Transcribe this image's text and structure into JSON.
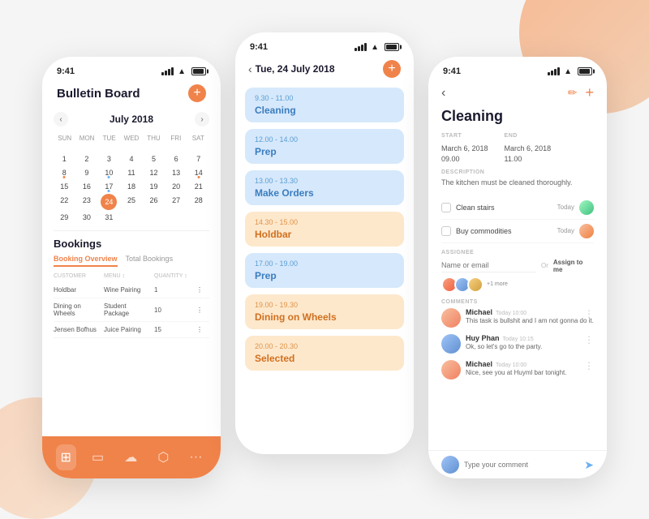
{
  "background": {
    "color": "#f0f0ee"
  },
  "phone1": {
    "status_time": "9:41",
    "header_title": "Bulletin Board",
    "plus_label": "+",
    "calendar": {
      "month": "July 2018",
      "day_names": [
        "SUN",
        "MON",
        "TUE",
        "WED",
        "THU",
        "FRI",
        "SAT"
      ],
      "weeks": [
        [
          {
            "n": ""
          },
          {
            "n": ""
          },
          {
            "n": ""
          },
          {
            "n": ""
          },
          {
            "n": ""
          },
          {
            "n": ""
          },
          {
            "n": ""
          }
        ],
        [
          {
            "n": "1"
          },
          {
            "n": "2"
          },
          {
            "n": "3"
          },
          {
            "n": "4"
          },
          {
            "n": "5"
          },
          {
            "n": "6"
          },
          {
            "n": "7"
          }
        ],
        [
          {
            "n": "8",
            "dot": "orange"
          },
          {
            "n": "9"
          },
          {
            "n": "10",
            "dot": "blue"
          },
          {
            "n": "11"
          },
          {
            "n": "12"
          },
          {
            "n": "13"
          },
          {
            "n": "14",
            "dot": "orange"
          }
        ],
        [
          {
            "n": "15"
          },
          {
            "n": "16"
          },
          {
            "n": "17",
            "dot": "blue"
          },
          {
            "n": "18"
          },
          {
            "n": "19"
          },
          {
            "n": "20"
          },
          {
            "n": "21"
          }
        ],
        [
          {
            "n": "22"
          },
          {
            "n": "23"
          },
          {
            "n": "24",
            "today": true
          },
          {
            "n": "25"
          },
          {
            "n": "26"
          },
          {
            "n": "27"
          },
          {
            "n": "28"
          }
        ],
        [
          {
            "n": "29"
          },
          {
            "n": "30"
          },
          {
            "n": "31"
          },
          {
            "n": ""
          },
          {
            "n": ""
          },
          {
            "n": ""
          },
          {
            "n": ""
          }
        ]
      ]
    },
    "bookings": {
      "title": "Bookings",
      "tabs": [
        "Booking Overview",
        "Total Bookings"
      ],
      "columns": [
        "CUSTOMER",
        "MENU",
        "QUANTITY",
        ""
      ],
      "rows": [
        {
          "customer": "Holdbar",
          "menu": "Wine Pairing",
          "quantity": "1"
        },
        {
          "customer": "Dining on Wheels",
          "menu": "Student Package",
          "quantity": "10"
        },
        {
          "customer": "Jensen Bofhus",
          "menu": "Juice Pairing",
          "quantity": "15"
        }
      ]
    },
    "nav_icons": [
      "⊞",
      "▭",
      "☁",
      "⬡",
      "···"
    ]
  },
  "phone2": {
    "status_time": "9:41",
    "date": "Tue, 24 July 2018",
    "plus_label": "+",
    "items": [
      {
        "time": "9.30 - 11.00",
        "name": "Cleaning",
        "color": "blue"
      },
      {
        "time": "12.00 - 14.00",
        "name": "Prep",
        "color": "blue"
      },
      {
        "time": "13.00 - 13.30",
        "name": "Make Orders",
        "color": "blue"
      },
      {
        "time": "14.30 - 15.00",
        "name": "Holdbar",
        "color": "orange"
      },
      {
        "time": "17.00 - 19.00",
        "name": "Prep",
        "color": "blue"
      },
      {
        "time": "19.00 - 19.30",
        "name": "Dining on Wheels",
        "color": "orange"
      },
      {
        "time": "20.00 - 20.30",
        "name": "Selected",
        "color": "orange"
      }
    ]
  },
  "phone3": {
    "status_time": "9:41",
    "title": "Cleaning",
    "start_label": "START",
    "start_date": "March 6, 2018",
    "start_time": "09.00",
    "end_label": "END",
    "end_date": "March 6, 2018",
    "end_time": "11.00",
    "desc_label": "DESCRIPTION",
    "description": "The kitchen must be cleaned thoroughly.",
    "checklist": [
      {
        "text": "Clean stairs",
        "date": "Today"
      },
      {
        "text": "Buy commodities",
        "date": "Today"
      }
    ],
    "assignee_label": "ASSIGNEE",
    "assignee_placeholder": "Name or email",
    "or_text": "Or",
    "assign_me": "Assign to me",
    "more_count": "+1 more",
    "comments_label": "COMMENTS",
    "comments": [
      {
        "name": "Michael",
        "time": "Today 10:00",
        "text": "This task is bullshit and I am not gonna do it.",
        "avatar": "ca1"
      },
      {
        "name": "Huy Phan",
        "time": "Today 10:15",
        "text": "Ok, so let's go to the party.",
        "avatar": "ca2"
      },
      {
        "name": "Michael",
        "time": "Today 10:00",
        "text": "Nice, see you at Huyml bar tonight.",
        "avatar": "ca1"
      }
    ],
    "comment_placeholder": "Type your comment"
  }
}
